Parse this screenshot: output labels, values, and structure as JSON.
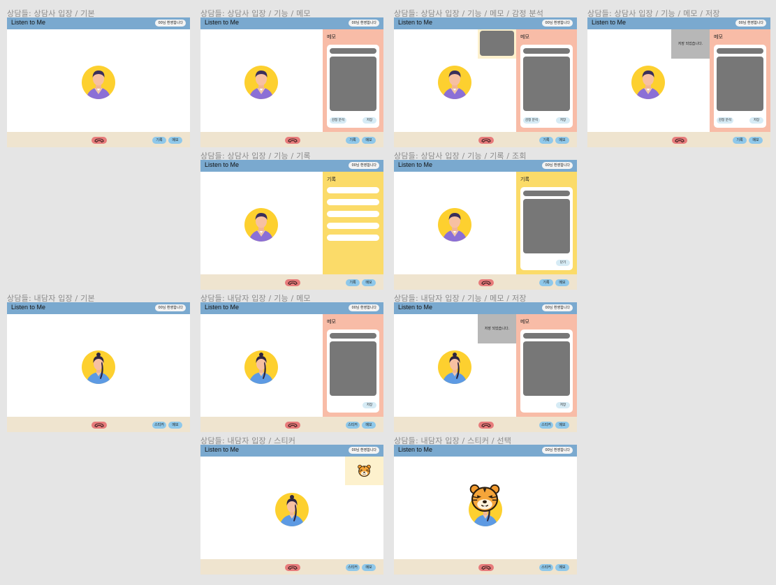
{
  "app": {
    "title": "Listen to Me",
    "welcome": "00님 환영합니다"
  },
  "frames": [
    {
      "title": "상담들: 상담사 입장 / 기본",
      "buttons": [
        "기록",
        "메모"
      ]
    },
    {
      "title": "상담들: 상담사 입장 / 기능 / 메모",
      "buttons": [
        "기록",
        "메모"
      ],
      "panel_title": "메모",
      "card_buttons": [
        "감정 분석",
        "저장"
      ]
    },
    {
      "title": "상담들: 상담사 입장 / 기능 / 메모 / 감정 분석",
      "buttons": [
        "기록",
        "메모"
      ],
      "panel_title": "메모",
      "card_buttons": [
        "감정 분석",
        "저장"
      ]
    },
    {
      "title": "상담들: 상담사 입장 / 기능 / 메모 / 저장",
      "buttons": [
        "기록",
        "메모"
      ],
      "panel_title": "메모",
      "card_buttons": [
        "감정 분석",
        "저장"
      ],
      "toast": "저장 되었습니다."
    },
    {
      "title": "상담들: 상담사 입장 / 기능 / 기록",
      "buttons": [
        "기록",
        "메모"
      ],
      "panel_title": "기록"
    },
    {
      "title": "상담들: 상담사 입장 / 기능 / 기록 / 조회",
      "buttons": [
        "기록",
        "메모"
      ],
      "panel_title": "기록",
      "card_buttons": [
        "닫기"
      ]
    },
    {
      "title": "상담들: 내담자 입장 / 기본",
      "buttons": [
        "스티커",
        "메모"
      ]
    },
    {
      "title": "상담들: 내담자 입장 / 기능 / 메모",
      "buttons": [
        "스티커",
        "메모"
      ],
      "panel_title": "메모",
      "card_buttons": [
        "저장"
      ]
    },
    {
      "title": "상담들: 내담자 입장 / 기능 / 메모 / 저장",
      "buttons": [
        "스티커",
        "메모"
      ],
      "panel_title": "메모",
      "card_buttons": [
        "저장"
      ],
      "toast": "저장 되었습니다."
    },
    {
      "title": "상담들: 내담자 입장 / 스티커",
      "buttons": [
        "스티커",
        "메모"
      ]
    },
    {
      "title": "상담들: 내담자 입장 / 스티커 / 선택",
      "buttons": [
        "스티커",
        "메모"
      ]
    }
  ],
  "icons": {
    "hangup": "phone-hangup-icon",
    "counselor": "counselor-avatar-icon",
    "client": "client-avatar-icon",
    "sticker": "tiger-sticker-icon"
  },
  "colors": {
    "header": "#7aa9cf",
    "footer": "#efe4cf",
    "memo_panel": "#f8bca7",
    "record_panel": "#fbdb69",
    "hangup": "#e77b7b",
    "pill": "#8fc8ea"
  }
}
